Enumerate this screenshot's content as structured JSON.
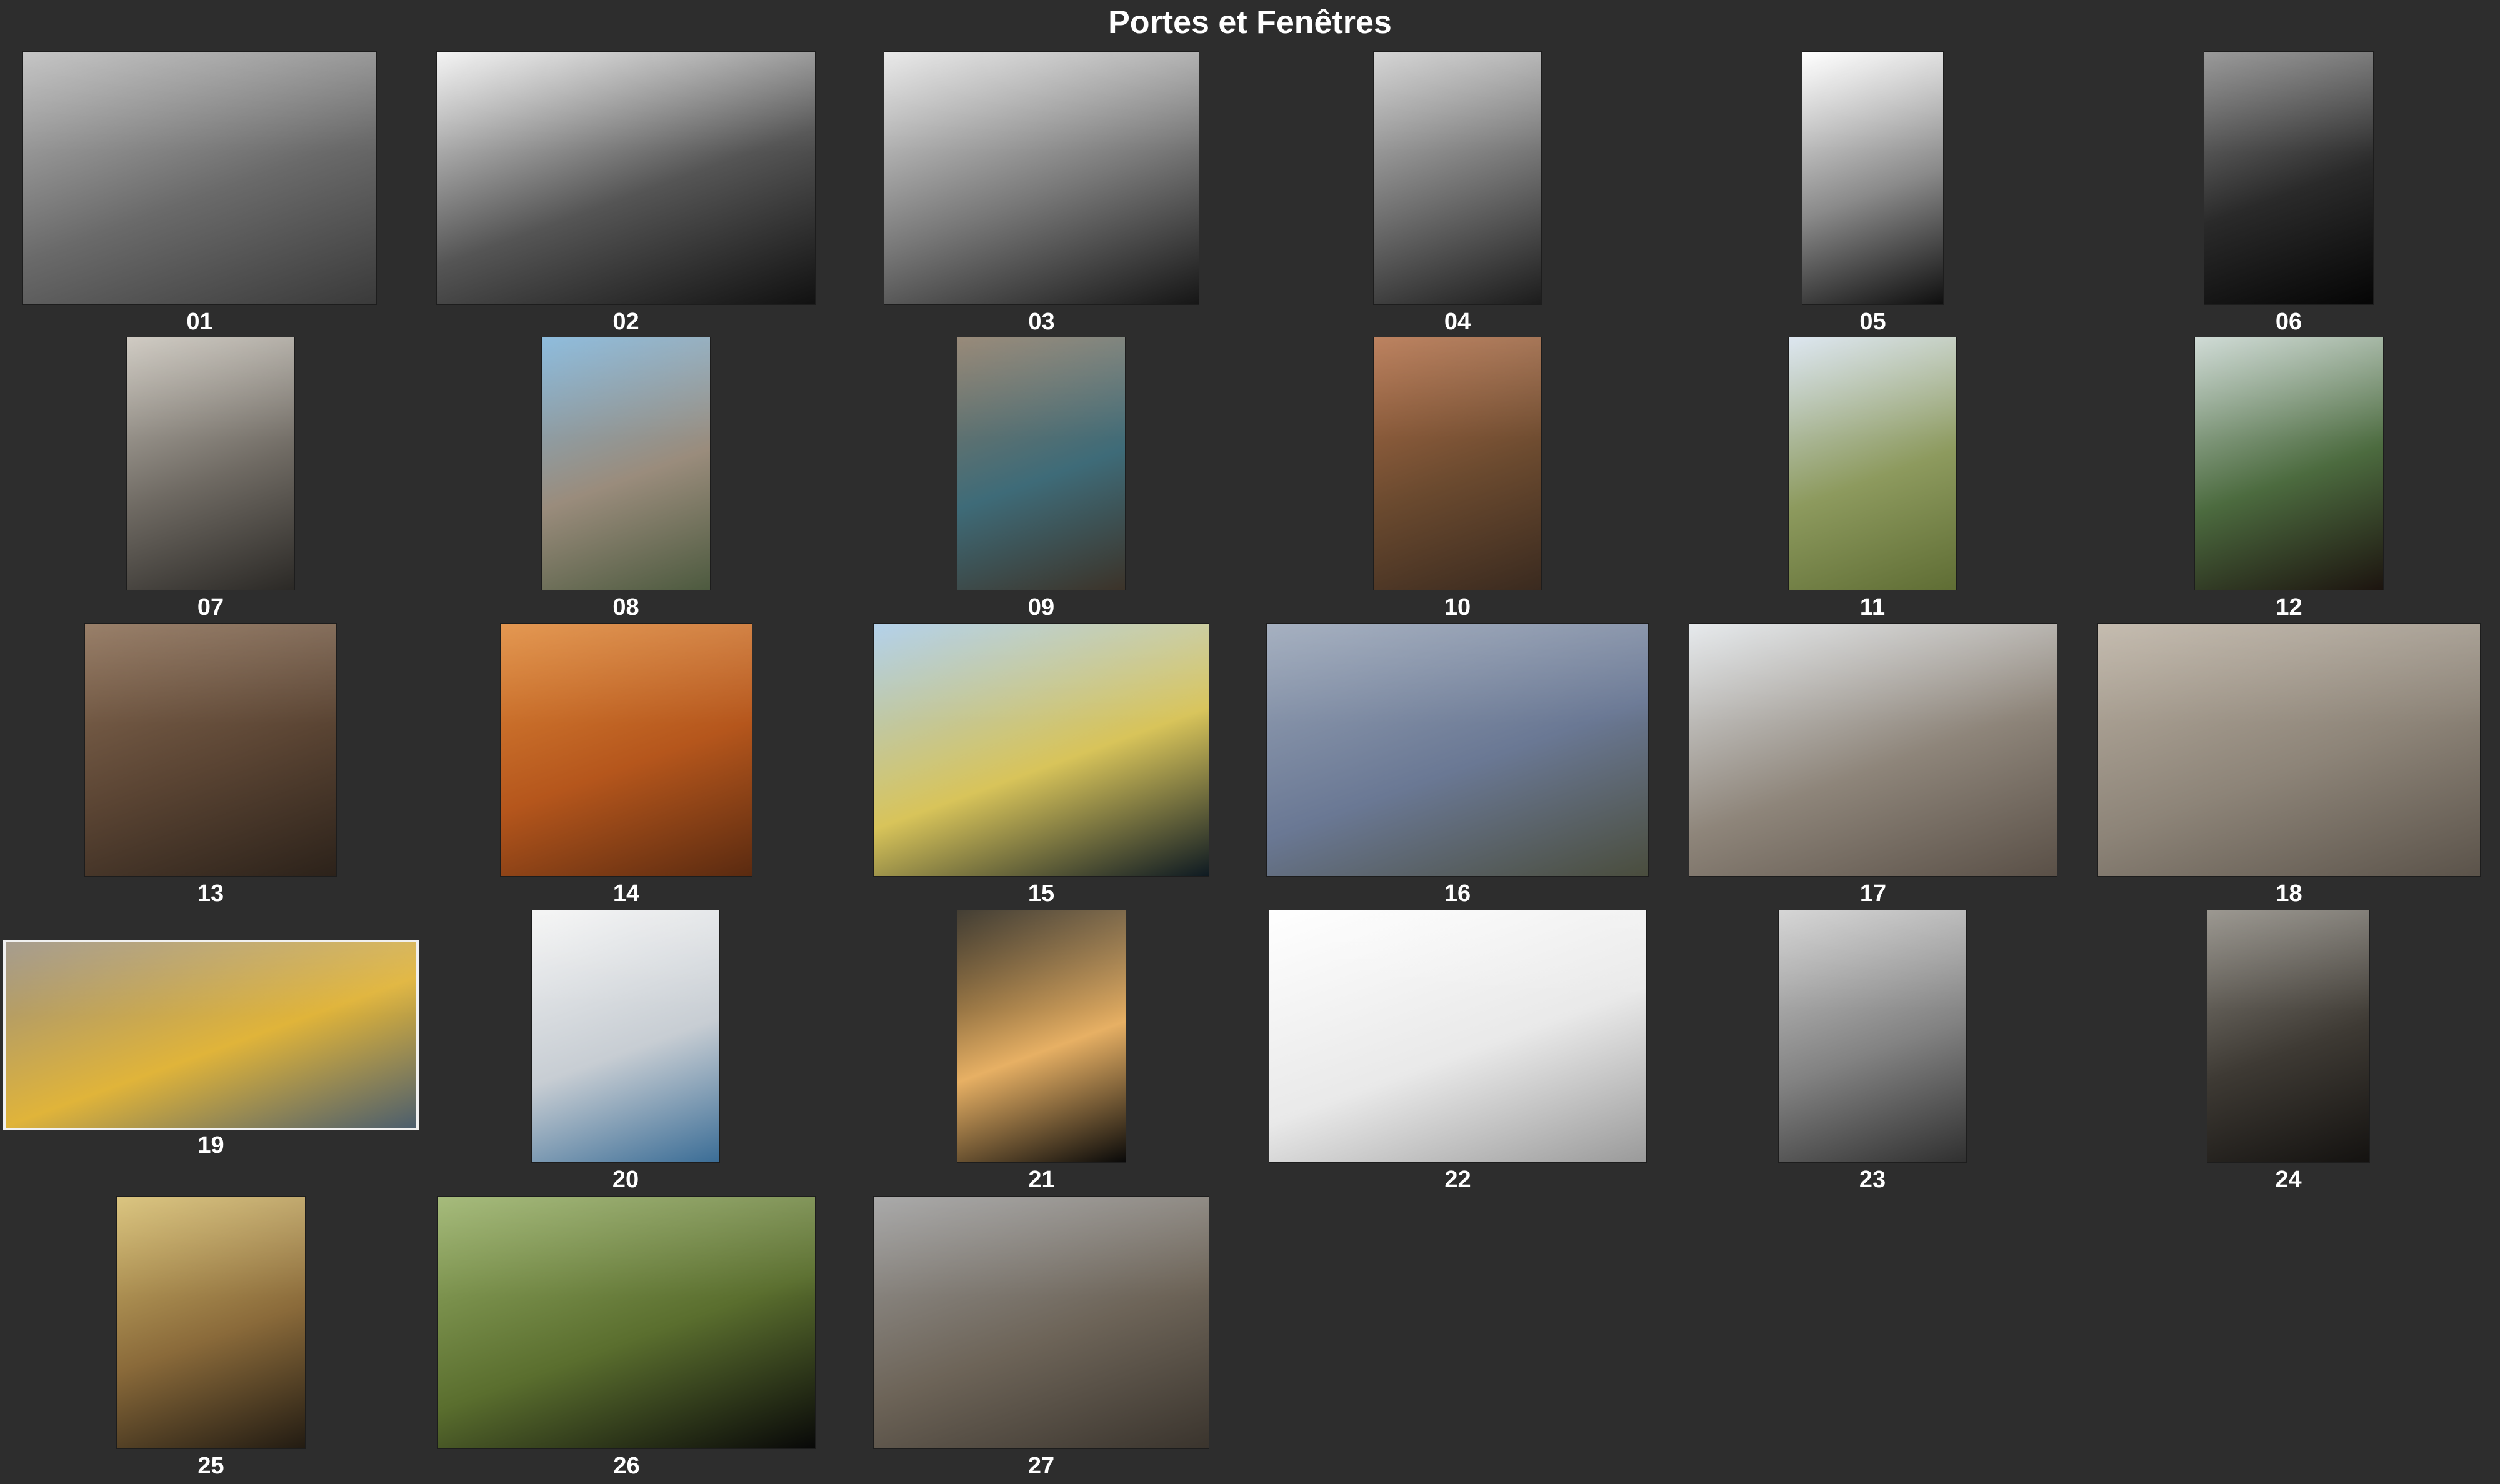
{
  "title": "Portes et Fenêtres",
  "gallery": {
    "items": [
      {
        "label": "01",
        "colors": [
          "#bdbdbd",
          "#6a6a6a",
          "#3a3a3a"
        ]
      },
      {
        "label": "02",
        "colors": [
          "#f2f2f2",
          "#555555",
          "#111111"
        ]
      },
      {
        "label": "03",
        "colors": [
          "#e6e6e6",
          "#777777",
          "#161616"
        ]
      },
      {
        "label": "04",
        "colors": [
          "#cfcfcf",
          "#6e6e6e",
          "#1c1c1c"
        ]
      },
      {
        "label": "05",
        "colors": [
          "#ffffff",
          "#8a8a8a",
          "#0f0f0f"
        ]
      },
      {
        "label": "06",
        "colors": [
          "#8c8c8c",
          "#2a2a2a",
          "#050505"
        ]
      },
      {
        "label": "07",
        "colors": [
          "#c9c4bb",
          "#6f6a63",
          "#2b2926"
        ]
      },
      {
        "label": "08",
        "colors": [
          "#7fb3d8",
          "#9a8c7c",
          "#4d5a3f"
        ]
      },
      {
        "label": "09",
        "colors": [
          "#8a7a67",
          "#3e6b78",
          "#3c3329"
        ]
      },
      {
        "label": "10",
        "colors": [
          "#b3714a",
          "#6b4a2f",
          "#3a2a1f"
        ]
      },
      {
        "label": "11",
        "colors": [
          "#d8e3ee",
          "#8d9a5e",
          "#5f6d34"
        ]
      },
      {
        "label": "12",
        "colors": [
          "#c9d6d0",
          "#4c6b3f",
          "#1c140f"
        ]
      },
      {
        "label": "13",
        "colors": [
          "#8b6e55",
          "#5a4433",
          "#2c221a"
        ]
      },
      {
        "label": "14",
        "colors": [
          "#e08a3a",
          "#b5561c",
          "#5a2a10"
        ]
      },
      {
        "label": "15",
        "colors": [
          "#a9cbe8",
          "#d8c45a",
          "#0e1a22"
        ]
      },
      {
        "label": "16",
        "colors": [
          "#9aa6b8",
          "#6a7894",
          "#4a4d3d"
        ]
      },
      {
        "label": "17",
        "colors": [
          "#e3e7ea",
          "#8e857a",
          "#5a5047"
        ]
      },
      {
        "label": "18",
        "colors": [
          "#bdb3a5",
          "#8d8478",
          "#5b534a"
        ]
      },
      {
        "label": "19",
        "colors": [
          "#9a8f7f",
          "#e0b43a",
          "#4c5e6d"
        ]
      },
      {
        "label": "20",
        "colors": [
          "#f4f4f4",
          "#c7cdd3",
          "#3b6d96"
        ]
      },
      {
        "label": "21",
        "colors": [
          "#2a2418",
          "#e7b064",
          "#090909"
        ]
      },
      {
        "label": "22",
        "colors": [
          "#ffffff",
          "#e9e9e9",
          "#9a9a9a"
        ]
      },
      {
        "label": "23",
        "colors": [
          "#d0d0d0",
          "#828282",
          "#303030"
        ]
      },
      {
        "label": "24",
        "colors": [
          "#8e8a82",
          "#3e3a34",
          "#141210"
        ]
      },
      {
        "label": "25",
        "colors": [
          "#d6bd6f",
          "#8a6a3a",
          "#221b12"
        ]
      },
      {
        "label": "26",
        "colors": [
          "#9ab26a",
          "#5a6e2e",
          "#080808"
        ]
      },
      {
        "label": "27",
        "colors": [
          "#9e9e9e",
          "#6d6458",
          "#3a342d"
        ]
      }
    ]
  }
}
